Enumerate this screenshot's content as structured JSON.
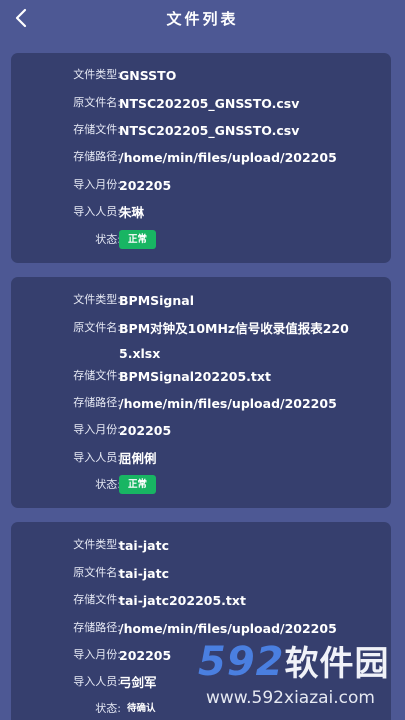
{
  "header": {
    "title": "文件列表",
    "back_icon": "chevron-left-icon"
  },
  "labels": {
    "type": "文件类型:",
    "original": "原文件名:",
    "stored": "存储文件:",
    "path": "存储路径:",
    "month": "导入月份:",
    "person": "导入人员:",
    "status": "状态:"
  },
  "files": [
    {
      "type": "GNSSTO",
      "original": "NTSC202205_GNSSTO.csv",
      "stored": "NTSC202205_GNSSTO.csv",
      "path": "/home/min/files/upload/202205",
      "month": "202205",
      "person": "朱琳",
      "status": "正常"
    },
    {
      "type": "BPMSignal",
      "original": "BPM对钟及10MHz信号收录值报表2205.xlsx",
      "stored": "BPMSignal202205.txt",
      "path": "/home/min/files/upload/202205",
      "month": "202205",
      "person": "屈俐俐",
      "status": "正常"
    },
    {
      "type": "tai-jatc",
      "original": "tai-jatc",
      "stored": "tai-jatc202205.txt",
      "path": "/home/min/files/upload/202205",
      "month": "202205",
      "person": "弓剑军",
      "status": "待确认"
    }
  ],
  "watermark": {
    "logo_number": "592",
    "logo_text": "软件园",
    "url": "www.592xiazai.com"
  },
  "colors": {
    "background": "#4d5894",
    "card": "#363f6e",
    "status_ok": "#18b563"
  }
}
